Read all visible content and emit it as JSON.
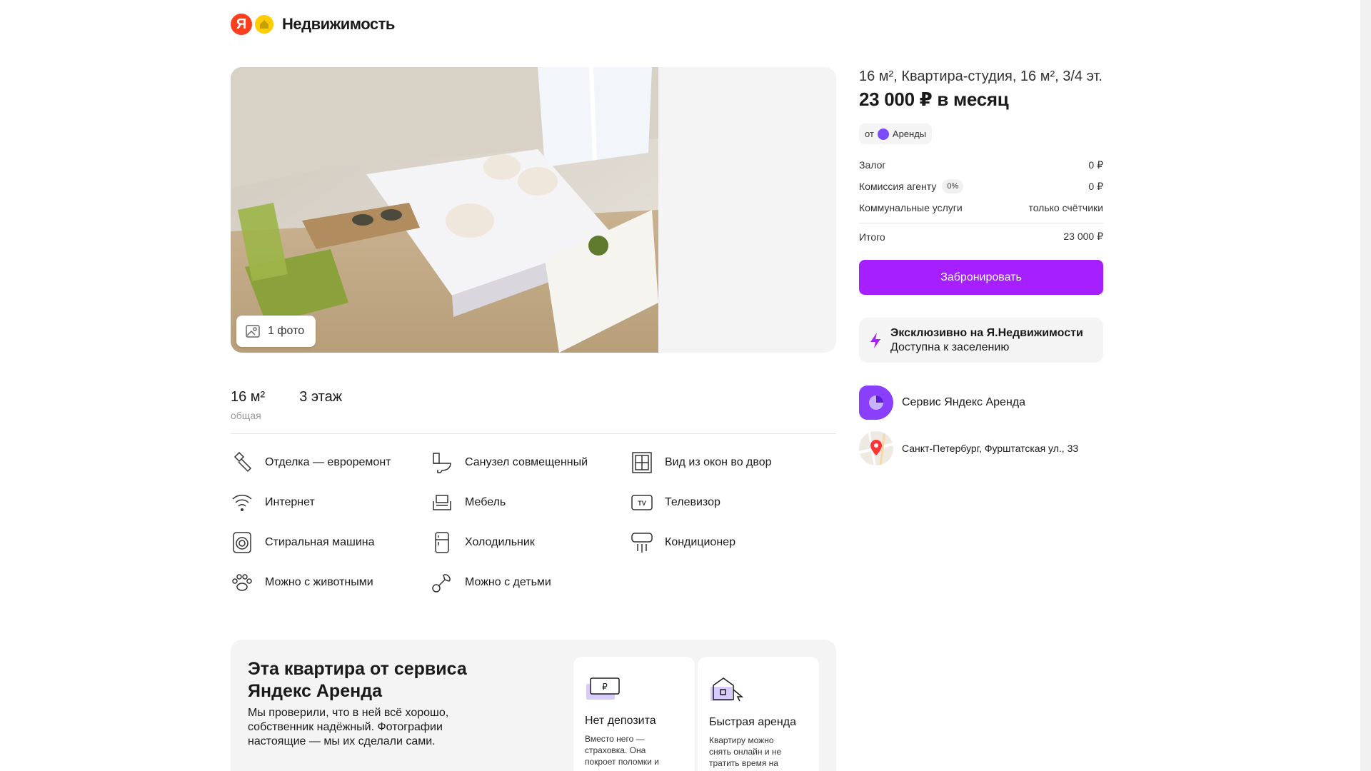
{
  "header": {
    "logo_letter": "Я",
    "logo_text": "Недвижимость"
  },
  "gallery": {
    "photo_count_label": "1 фото"
  },
  "params": [
    {
      "value": "16 м²",
      "sub": "общая"
    },
    {
      "value": "3 этаж",
      "sub": ""
    }
  ],
  "amenities": [
    {
      "label": "Отделка — евроремонт",
      "icon": "renovation-icon"
    },
    {
      "label": "Санузел совмещенный",
      "icon": "toilet-icon"
    },
    {
      "label": "Вид из окон во двор",
      "icon": "window-icon"
    },
    {
      "label": "Интернет",
      "icon": "wifi-icon"
    },
    {
      "label": "Мебель",
      "icon": "armchair-icon"
    },
    {
      "label": "Телевизор",
      "icon": "tv-icon"
    },
    {
      "label": "Стиральная машина",
      "icon": "washing-machine-icon"
    },
    {
      "label": "Холодильник",
      "icon": "fridge-icon"
    },
    {
      "label": "Кондиционер",
      "icon": "air-conditioner-icon"
    },
    {
      "label": "Можно с животными",
      "icon": "paw-icon"
    },
    {
      "label": "Можно с детьми",
      "icon": "pacifier-icon"
    }
  ],
  "promo": {
    "title": "Эта квартира от сервиса Яндекс Аренда",
    "text": "Мы проверили, что в ней всё хорошо, собственник надёжный. Фотографии настоящие — мы их сделали сами.",
    "cards": [
      {
        "title": "Нет депозита",
        "text": "Вместо него — страховка. Она покроет поломки и уже входит в стоимость аренды."
      },
      {
        "title": "Быстрая аренда",
        "text": "Квартиру можно снять онлайн и не тратить время на дорогу."
      }
    ]
  },
  "offer": {
    "title": "16 м², Квартира-студия, 16 м², 3/4 эт.",
    "price": "23 000 ₽ в месяц",
    "badge_prefix": "от",
    "badge_text": "Аренды",
    "fees": [
      {
        "label": "Залог",
        "chip": "",
        "value": "0 ₽"
      },
      {
        "label": "Комиссия агенту",
        "chip": "0%",
        "value": "0 ₽"
      },
      {
        "label": "Коммунальные услуги",
        "chip": "",
        "value": "только счётчики"
      }
    ],
    "total": {
      "label": "Итого",
      "value": "23 000 ₽"
    },
    "book_label": "Забронировать",
    "exclusive_title": "Эксклюзивно на Я.Недвижимости",
    "exclusive_sub": "Доступна к заселению",
    "service_label": "Сервис Яндекс Аренда",
    "address": "Санкт-Петербург, Фурштатская ул., 33"
  },
  "colors": {
    "accent": "#a51fff",
    "yandex_red": "#fc3f1d",
    "realty_yellow": "#ffcc00",
    "panel_bg": "#f4f4f4"
  }
}
